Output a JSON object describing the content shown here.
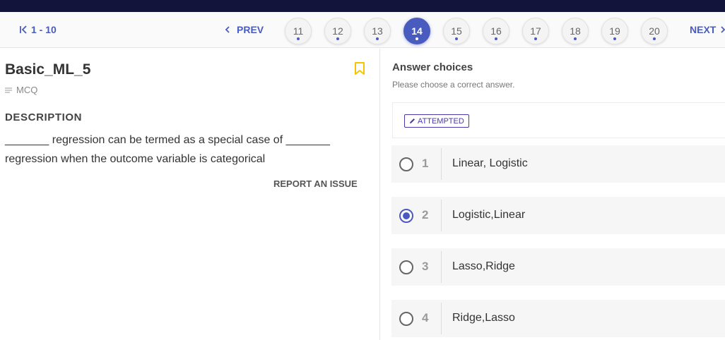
{
  "nav": {
    "range_label": "1 - 10",
    "prev_label": "PREV",
    "next_label": "NEXT",
    "questions": [
      {
        "label": "11",
        "active": false
      },
      {
        "label": "12",
        "active": false
      },
      {
        "label": "13",
        "active": false
      },
      {
        "label": "14",
        "active": true
      },
      {
        "label": "15",
        "active": false
      },
      {
        "label": "16",
        "active": false
      },
      {
        "label": "17",
        "active": false
      },
      {
        "label": "18",
        "active": false
      },
      {
        "label": "19",
        "active": false
      },
      {
        "label": "20",
        "active": false
      }
    ]
  },
  "question": {
    "title": "Basic_ML_5",
    "type": "MCQ",
    "description_heading": "DESCRIPTION",
    "description": "_______ regression can be termed as a special case of _______ regression when the outcome variable is categorical",
    "report_label": "REPORT AN ISSUE",
    "bookmark_icon": "bookmark-icon"
  },
  "answers": {
    "heading": "Answer choices",
    "subheading": "Please choose a correct answer.",
    "status_badge": "ATTEMPTED",
    "options": [
      {
        "num": "1",
        "text": "Linear, Logistic",
        "selected": false
      },
      {
        "num": "2",
        "text": "Logistic,Linear",
        "selected": true
      },
      {
        "num": "3",
        "text": "Lasso,Ridge",
        "selected": false
      },
      {
        "num": "4",
        "text": "Ridge,Lasso",
        "selected": false
      }
    ]
  },
  "colors": {
    "accent": "#4a5bbf",
    "topbar": "#13143b",
    "bookmark": "#f5c400",
    "badge": "#4a3aa8"
  }
}
